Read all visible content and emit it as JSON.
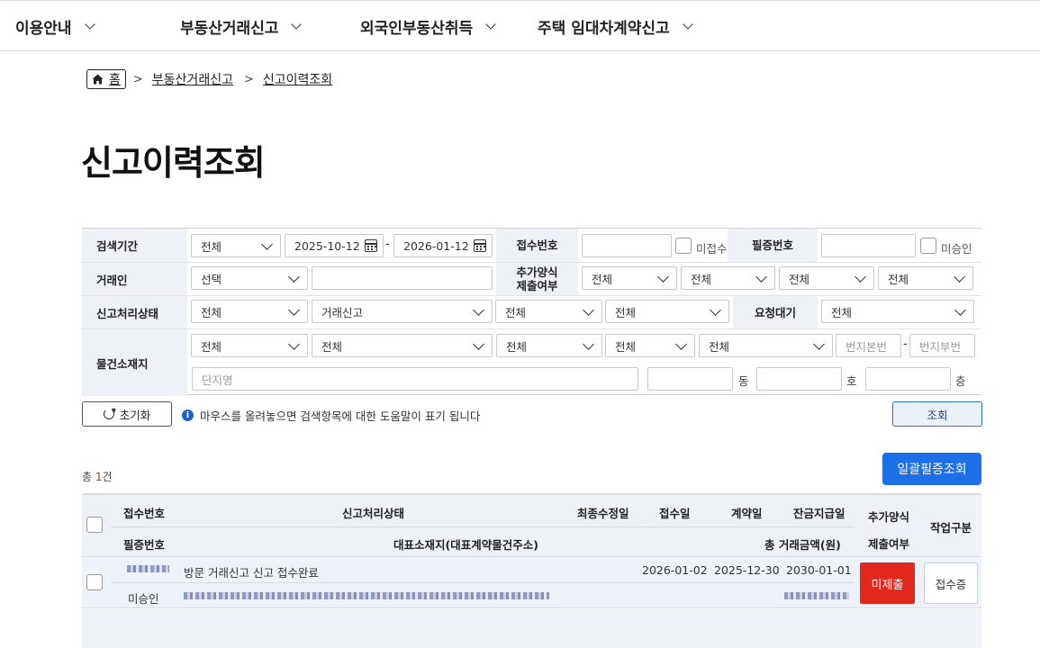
{
  "topnav": {
    "items": [
      "이용안내",
      "부동산거래신고",
      "외국인부동산취득",
      "주택 임대차계약신고"
    ]
  },
  "breadcrumb": {
    "home": "홈",
    "level1": "부동산거래신고",
    "level2": "신고이력조회"
  },
  "page": {
    "title": "신고이력조회"
  },
  "search": {
    "labels": {
      "period": "검색기간",
      "receipt_no": "접수번호",
      "cert_no": "필증번호",
      "party": "거래인",
      "additional": "추가양식\n제출여부",
      "status": "신고처리상태",
      "request_wait": "요청대기",
      "location": "물건소재지"
    },
    "period_select": "전체",
    "date_from": "2025-10-12",
    "date_to": "2026-01-12",
    "dash": "-",
    "receipt_no_value": "",
    "not_received_label": "미접수",
    "cert_no_value": "",
    "not_approved_label": "미승인",
    "party_select": "선택",
    "party_value": "",
    "additional_selects": [
      "전체",
      "전체",
      "전체",
      "전체"
    ],
    "status_selects": [
      "전체",
      "거래신고",
      "전체",
      "전체"
    ],
    "request_wait_select": "전체",
    "location_selects": [
      "전체",
      "전체",
      "전체",
      "전체",
      "전체"
    ],
    "lot_main_placeholder": "번지본번",
    "lot_sub_placeholder": "번지부번",
    "complex_placeholder": "단지명",
    "unit_dong": "동",
    "unit_ho": "호",
    "unit_floor": "층"
  },
  "actions": {
    "reset": "초기화",
    "info": "마우스를 올려놓으면 검색항목에 대한 도움말이 표기 됩니다",
    "search": "조회",
    "bulk": "일괄필증조회"
  },
  "total": {
    "prefix": "총 ",
    "count": "1",
    "suffix": "건"
  },
  "table": {
    "headers": {
      "receipt_no": "접수번호",
      "status": "신고처리상태",
      "last_modified": "최종수정일",
      "received": "접수일",
      "contract": "계약일",
      "balance": "잔금지급일",
      "additional": "추가양식\n제출여부",
      "work": "작업구분",
      "cert_no": "필증번호",
      "address": "대표소재지(대표계약물건주소)",
      "total_amount": "총 거래금액(원)"
    },
    "rows": [
      {
        "status": "방문 거래신고 신고 접수완료",
        "last_modified": "2026-01-02",
        "received": "2025-12-30",
        "contract": "2030-01-01",
        "cert_no": "미승인",
        "submit_badge": "미제출",
        "cert_button": "접수증"
      }
    ]
  },
  "colors": {
    "primary_blue": "#1d6fe8",
    "danger_red": "#e0281d",
    "label_bg": "#eef1f6"
  }
}
